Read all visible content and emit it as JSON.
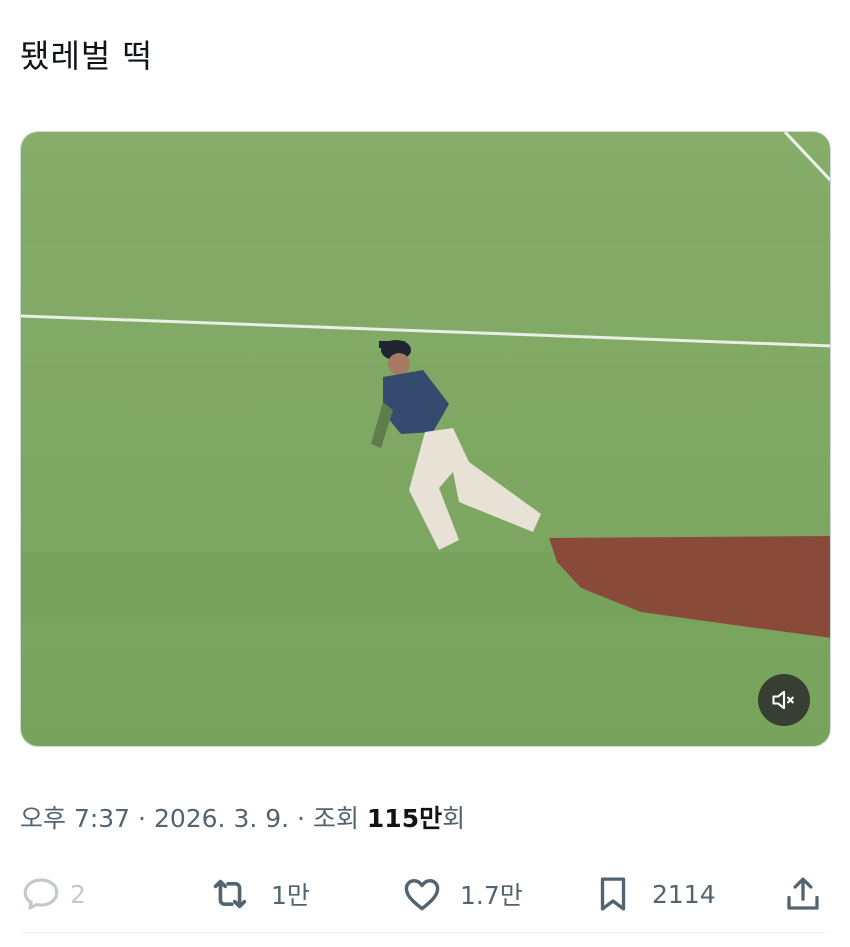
{
  "tweet": {
    "text": "됐레벌 떡"
  },
  "media": {
    "type": "video",
    "mute_icon": "speaker-muted-icon"
  },
  "meta": {
    "time": "오후 7:37",
    "sep1": " · ",
    "date": "2026. 3. 9.",
    "sep2": " · ",
    "views_label": "조회 ",
    "views_count": "115만",
    "views_suffix": "회"
  },
  "actions": {
    "reply": {
      "icon": "reply-icon",
      "count": "2"
    },
    "retweet": {
      "icon": "retweet-icon",
      "count": "1만"
    },
    "like": {
      "icon": "heart-icon",
      "count": "1.7만"
    },
    "bookmark": {
      "icon": "bookmark-icon",
      "count": "2114"
    },
    "share": {
      "icon": "share-icon"
    }
  },
  "colors": {
    "text": "#0f1419",
    "secondary": "#536471",
    "grass": "#7ba65e",
    "dirt": "#8a4a3a"
  }
}
